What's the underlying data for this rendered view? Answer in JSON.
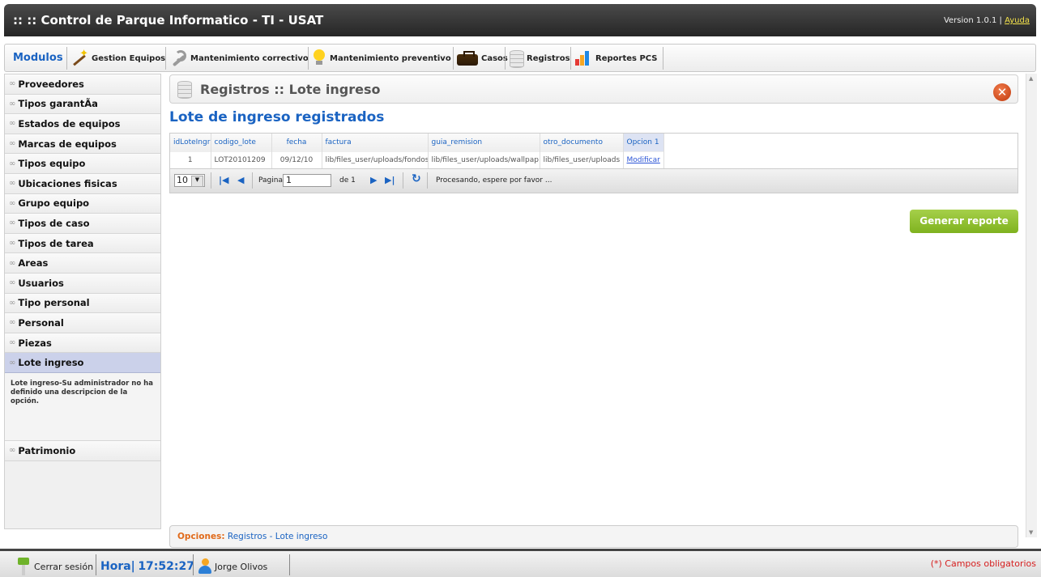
{
  "header": {
    "title": ":: :: Control de Parque Informatico - TI - USAT",
    "version": "Version 1.0.1 | ",
    "help": "Ayuda"
  },
  "menu": {
    "label": "Modulos",
    "items": [
      {
        "label": "Gestion Equipos",
        "icon": "magic-wand-icon"
      },
      {
        "label": "Mantenimiento correctivo",
        "icon": "wrench-icon"
      },
      {
        "label": "Mantenimiento preventivo",
        "icon": "lightbulb-icon"
      },
      {
        "label": "Casos",
        "icon": "briefcase-icon"
      },
      {
        "label": "Registros",
        "icon": "database-icon"
      },
      {
        "label": "Reportes PCS",
        "icon": "bar-chart-icon"
      }
    ]
  },
  "sidebar": {
    "items": [
      {
        "label": "Proveedores"
      },
      {
        "label": "Tipos garantÃa"
      },
      {
        "label": "Estados de equipos"
      },
      {
        "label": "Marcas de equipos"
      },
      {
        "label": "Tipos equipo"
      },
      {
        "label": "Ubicaciones fisicas"
      },
      {
        "label": "Grupo equipo"
      },
      {
        "label": "Tipos de caso"
      },
      {
        "label": "Tipos de tarea"
      },
      {
        "label": "Areas"
      },
      {
        "label": "Usuarios"
      },
      {
        "label": "Tipo personal"
      },
      {
        "label": "Personal"
      },
      {
        "label": "Piezas"
      },
      {
        "label": "Lote ingreso"
      },
      {
        "label": "Patrimonio"
      }
    ],
    "chain_icon": "∞",
    "active_description": "Lote ingreso-Su administrador no ha definido una descripcion de la opción."
  },
  "page": {
    "title": "Registros  :: Lote ingreso",
    "close_icon": "close-icon",
    "section_title": "Lote de ingreso registrados"
  },
  "grid": {
    "columns": [
      "idLoteIngr",
      "codigo_lote",
      "fecha",
      "factura",
      "guia_remision",
      "otro_documento",
      "Opcion 1"
    ],
    "rows": [
      [
        "1",
        "LOT20101209",
        "09/12/10",
        "lib/files_user/uploads/fondos",
        "lib/files_user/uploads/wallpap",
        "lib/files_user/uploads",
        "Modificar"
      ]
    ]
  },
  "pager": {
    "page_size": "10",
    "page_label": "Pagina",
    "page_value": "1",
    "of_label": "de 1",
    "status": "Procesando, espere por favor ..."
  },
  "actions": {
    "generate_report": "Generar reporte"
  },
  "options_bar": {
    "label": "Opciones:",
    "path": "Registros  - Lote ingreso"
  },
  "footer": {
    "logout": "Cerrar sesión",
    "time_label": "Hora|",
    "time_value": "17:52:27",
    "user": "Jorge Olivos",
    "required_note": "(*) Campos obligatorios"
  }
}
